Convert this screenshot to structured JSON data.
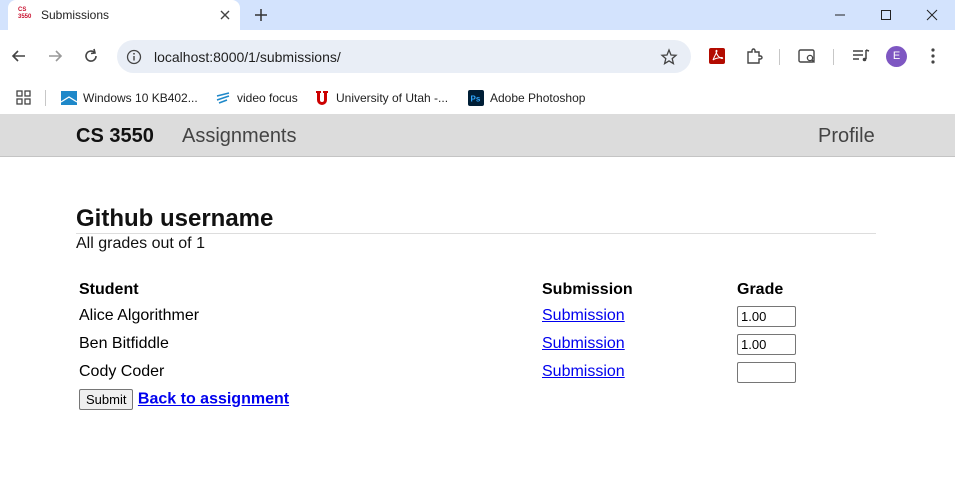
{
  "browser": {
    "tab_title": "Submissions",
    "favicon_text": "CS 3550",
    "url": "localhost:8000/1/submissions/",
    "profile_initial": "E",
    "bookmarks": [
      {
        "label": "Windows 10 KB402...",
        "icon": "windows-icon"
      },
      {
        "label": "video focus",
        "icon": "video-focus-icon"
      },
      {
        "label": "University of Utah -...",
        "icon": "utah-u-icon"
      },
      {
        "label": "Adobe Photoshop",
        "icon": "photoshop-icon"
      }
    ]
  },
  "nav": {
    "brand": "CS 3550",
    "assignments": "Assignments",
    "profile": "Profile"
  },
  "page": {
    "title": "Github username",
    "subtitle": "All grades out of 1"
  },
  "table": {
    "headers": {
      "student": "Student",
      "submission": "Submission",
      "grade": "Grade"
    },
    "rows": [
      {
        "student": "Alice Algorithmer",
        "submission": "Submission",
        "grade": "1.00"
      },
      {
        "student": "Ben Bitfiddle",
        "submission": "Submission",
        "grade": "1.00"
      },
      {
        "student": "Cody Coder",
        "submission": "Submission",
        "grade": ""
      }
    ]
  },
  "actions": {
    "submit": "Submit",
    "back": "Back to assignment"
  },
  "colors": {
    "nav_bg": "#dcdcdc",
    "link": "#0000ee",
    "tabstrip": "#d3e3fd",
    "avatar": "#7e57c2"
  }
}
